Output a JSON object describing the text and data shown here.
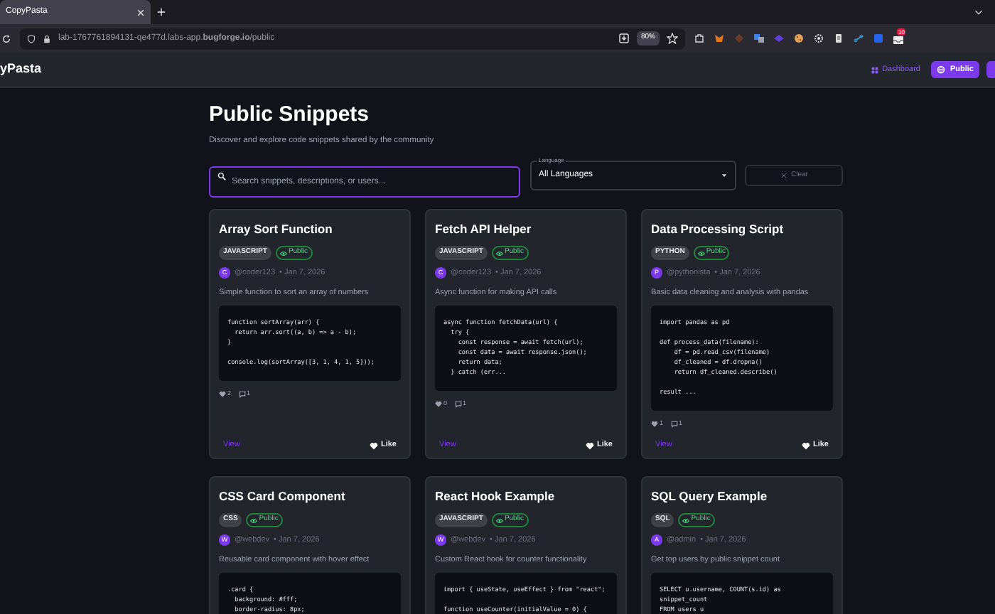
{
  "browser": {
    "tab_title": "CopyPasta",
    "url": "lab-1767761894131-qe477d.labs-app.**bugforge.io**/public",
    "zoom": "80%",
    "badge": "10"
  },
  "header": {
    "brand": "yPasta",
    "nav": [
      {
        "label": "Dashboard",
        "selected": false
      },
      {
        "label": "Public",
        "selected": true
      }
    ]
  },
  "page": {
    "title": "Public Snippets",
    "subtitle": "Discover and explore code snippets shared by the community"
  },
  "filters": {
    "search_placeholder": "Search snippets, descriptions, or users...",
    "language_label": "Language",
    "language_value": "All Languages",
    "clear": "Clear"
  },
  "snippets": [
    {
      "title": "Array Sort Function",
      "language": "JAVASCRIPT",
      "visibility": "Public",
      "avatar": "C",
      "author": "@coder123",
      "date": "• Jan 7, 2026",
      "description": "Simple function to sort an array of numbers",
      "code": "function sortArray(arr) {\n  return arr.sort((a, b) => a - b);\n}\n\nconsole.log(sortArray([3, 1, 4, 1, 5]));",
      "likes": "2",
      "comments": "1",
      "view": "View",
      "like": "Like"
    },
    {
      "title": "Fetch API Helper",
      "language": "JAVASCRIPT",
      "visibility": "Public",
      "avatar": "C",
      "author": "@coder123",
      "date": "• Jan 7, 2026",
      "description": "Async function for making API calls",
      "code": "async function fetchData(url) {\n  try {\n    const response = await fetch(url);\n    const data = await response.json();\n    return data;\n  } catch (err...",
      "likes": "0",
      "comments": "1",
      "view": "View",
      "like": "Like"
    },
    {
      "title": "Data Processing Script",
      "language": "PYTHON",
      "visibility": "Public",
      "avatar": "P",
      "author": "@pythonista",
      "date": "• Jan 7, 2026",
      "description": "Basic data cleaning and analysis with pandas",
      "code": "import pandas as pd\n\ndef process_data(filename):\n    df = pd.read_csv(filename)\n    df_cleaned = df.dropna()\n    return df_cleaned.describe()\n\nresult ...",
      "likes": "1",
      "comments": "1",
      "view": "View",
      "like": "Like"
    },
    {
      "title": "CSS Card Component",
      "language": "CSS",
      "visibility": "Public",
      "avatar": "W",
      "author": "@webdev",
      "date": "• Jan 7, 2026",
      "description": "Reusable card component with hover effect",
      "code": ".card {\n  background: #fff;\n  border-radius: 8px;"
    },
    {
      "title": "React Hook Example",
      "language": "JAVASCRIPT",
      "visibility": "Public",
      "avatar": "W",
      "author": "@webdev",
      "date": "• Jan 7, 2026",
      "description": "Custom React hook for counter functionality",
      "code": "import { useState, useEffect } from \"react\";\n\nfunction useCounter(initialValue = 0) {"
    },
    {
      "title": "SQL Query Example",
      "language": "SQL",
      "visibility": "Public",
      "avatar": "A",
      "author": "@admin",
      "date": "• Jan 7, 2026",
      "description": "Get top users by public snippet count",
      "code": "SELECT u.username, COUNT(s.id) as\nsnippet_count\nFROM users u"
    }
  ]
}
